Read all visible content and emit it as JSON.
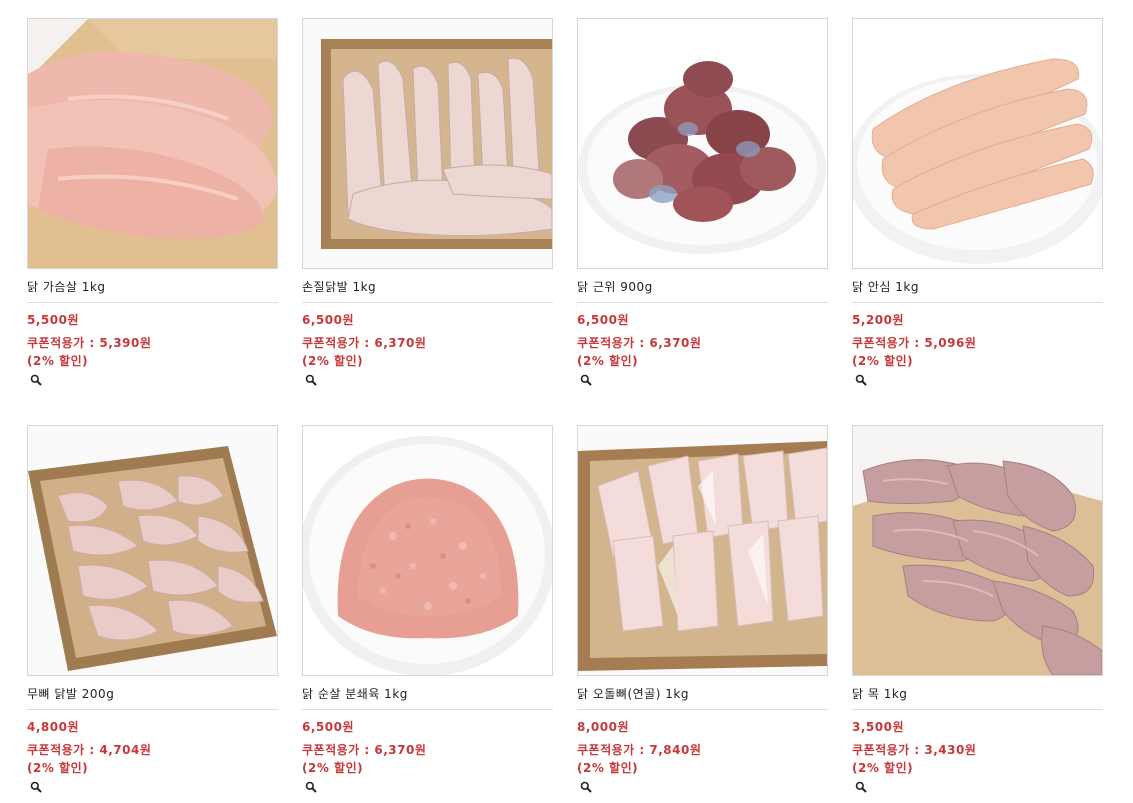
{
  "products": [
    {
      "name": "닭 가슴살 1kg",
      "price": "5,500원",
      "coupon_label": "쿠폰적용가 : ",
      "coupon_price": "5,390원",
      "discount": "(2% 할인)",
      "image": "chicken-breast-on-wooden-board",
      "zoom_icon": "zoom-icon"
    },
    {
      "name": "손질닭발 1kg",
      "price": "6,500원",
      "coupon_label": "쿠폰적용가 : ",
      "coupon_price": "6,370원",
      "discount": "(2% 할인)",
      "image": "chicken-feet-on-wooden-tray",
      "zoom_icon": "zoom-icon"
    },
    {
      "name": "닭 근위 900g",
      "price": "6,500원",
      "coupon_label": "쿠폰적용가 : ",
      "coupon_price": "6,370원",
      "discount": "(2% 할인)",
      "image": "chicken-gizzards-on-white-plate",
      "zoom_icon": "zoom-icon"
    },
    {
      "name": "닭 안심 1kg",
      "price": "5,200원",
      "coupon_label": "쿠폰적용가 : ",
      "coupon_price": "5,096원",
      "discount": "(2% 할인)",
      "image": "chicken-tenderloin-on-white-plate",
      "zoom_icon": "zoom-icon"
    },
    {
      "name": "무뼈 닭발 200g",
      "price": "4,800원",
      "coupon_label": "쿠폰적용가 : ",
      "coupon_price": "4,704원",
      "discount": "(2% 할인)",
      "image": "boneless-chicken-feet-on-wooden-tray",
      "zoom_icon": "zoom-icon"
    },
    {
      "name": "닭 순살 분쇄육 1kg",
      "price": "6,500원",
      "coupon_label": "쿠폰적용가 : ",
      "coupon_price": "6,370원",
      "discount": "(2% 할인)",
      "image": "ground-chicken-on-white-plate",
      "zoom_icon": "zoom-icon"
    },
    {
      "name": "닭 오돌뼈(연골) 1kg",
      "price": "8,000원",
      "coupon_label": "쿠폰적용가 : ",
      "coupon_price": "7,840원",
      "discount": "(2% 할인)",
      "image": "chicken-cartilage-on-wooden-tray",
      "zoom_icon": "zoom-icon"
    },
    {
      "name": "닭 목 1kg",
      "price": "3,500원",
      "coupon_label": "쿠폰적용가 : ",
      "coupon_price": "3,430원",
      "discount": "(2% 할인)",
      "image": "chicken-necks-on-wooden-board",
      "zoom_icon": "zoom-icon"
    }
  ],
  "colors": {
    "price_red": "#c6393b",
    "border": "#d6d6d6",
    "text": "#222222"
  }
}
